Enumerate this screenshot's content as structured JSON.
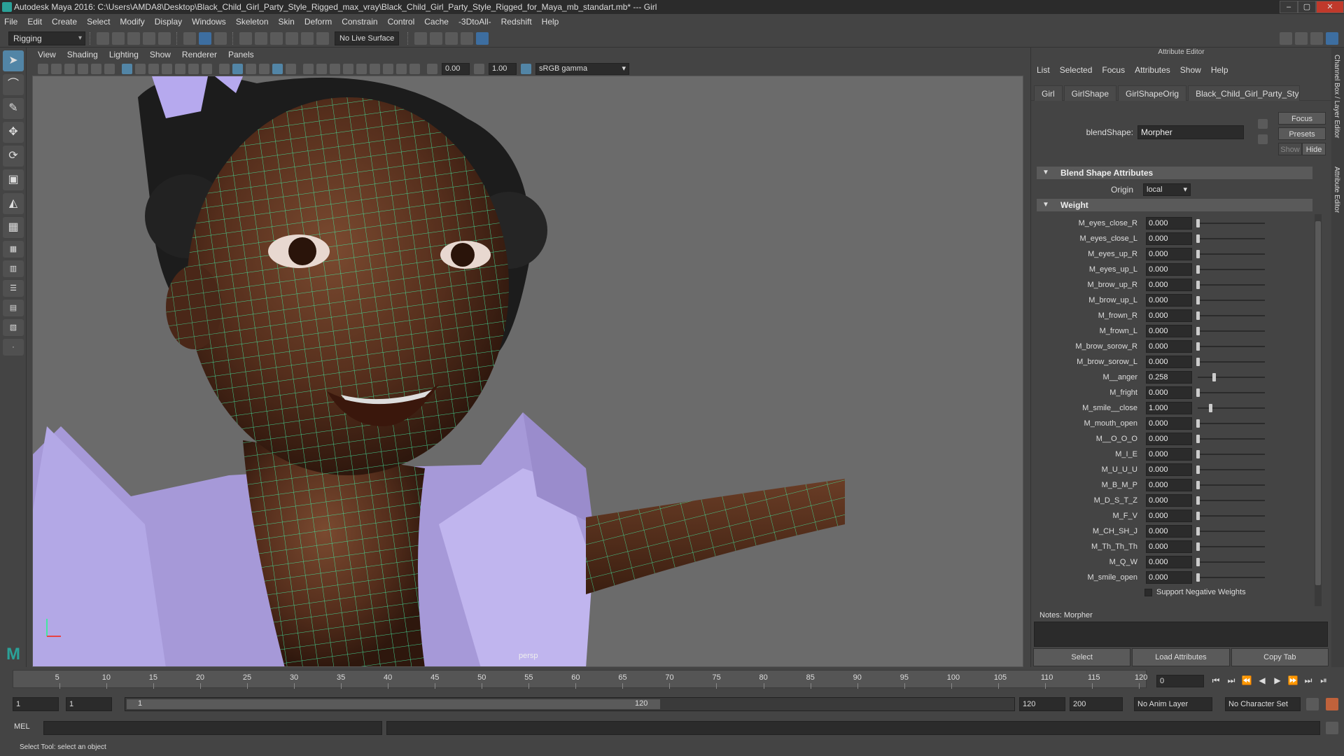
{
  "window": {
    "title": "Autodesk Maya 2016: C:\\Users\\AMDA8\\Desktop\\Black_Child_Girl_Party_Style_Rigged_max_vray\\Black_Child_Girl_Party_Style_Rigged_for_Maya_mb_standart.mb*  ---  Girl"
  },
  "menubar": [
    "File",
    "Edit",
    "Create",
    "Select",
    "Modify",
    "Display",
    "Windows",
    "Skeleton",
    "Skin",
    "Deform",
    "Constrain",
    "Control",
    "Cache",
    "-3DtoAll-",
    "Redshift",
    "Help"
  ],
  "statusline": {
    "menuset": "Rigging",
    "live_surface": "No Live Surface"
  },
  "viewport": {
    "menu": [
      "View",
      "Shading",
      "Lighting",
      "Show",
      "Renderer",
      "Panels"
    ],
    "near_value": "0.00",
    "far_value": "1.00",
    "color_space": "sRGB gamma",
    "camera_label": "persp"
  },
  "attribute_editor": {
    "title": "Attribute Editor",
    "menu": [
      "List",
      "Selected",
      "Focus",
      "Attributes",
      "Show",
      "Help"
    ],
    "tabs": [
      "Girl",
      "GirlShape",
      "GirlShapeOrig",
      "Black_Child_Girl_Party_Style_Rig"
    ],
    "focus_label": "Focus",
    "presets_label": "Presets",
    "show_label": "Show",
    "hide_label": "Hide",
    "blendshape_label": "blendShape:",
    "blendshape_value": "Morpher",
    "section_blend": "Blend Shape Attributes",
    "origin_label": "Origin",
    "origin_value": "local",
    "section_weight": "Weight",
    "weights": [
      {
        "name": "M_eyes_close_R",
        "value": "0.000",
        "level": 0
      },
      {
        "name": "M_eyes_close_L",
        "value": "0.000",
        "level": 0
      },
      {
        "name": "M_eyes_up_R",
        "value": "0.000",
        "level": 0
      },
      {
        "name": "M_eyes_up_L",
        "value": "0.000",
        "level": 0
      },
      {
        "name": "M_brow_up_R",
        "value": "0.000",
        "level": 0
      },
      {
        "name": "M_brow_up_L",
        "value": "0.000",
        "level": 0
      },
      {
        "name": "M_frown_R",
        "value": "0.000",
        "level": 0
      },
      {
        "name": "M_frown_L",
        "value": "0.000",
        "level": 0
      },
      {
        "name": "M_brow_sorow_R",
        "value": "0.000",
        "level": 0
      },
      {
        "name": "M_brow_sorow_L",
        "value": "0.000",
        "level": 0
      },
      {
        "name": "M__anger",
        "value": "0.258",
        "level": 0.258
      },
      {
        "name": "M_fright",
        "value": "0.000",
        "level": 0
      },
      {
        "name": "M_smile__close",
        "value": "1.000",
        "level": 0.2
      },
      {
        "name": "M_mouth_open",
        "value": "0.000",
        "level": 0
      },
      {
        "name": "M__O_O_O",
        "value": "0.000",
        "level": 0
      },
      {
        "name": "M_I_E",
        "value": "0.000",
        "level": 0
      },
      {
        "name": "M_U_U_U",
        "value": "0.000",
        "level": 0
      },
      {
        "name": "M_B_M_P",
        "value": "0.000",
        "level": 0
      },
      {
        "name": "M_D_S_T_Z",
        "value": "0.000",
        "level": 0
      },
      {
        "name": "M_F_V",
        "value": "0.000",
        "level": 0
      },
      {
        "name": "M_CH_SH_J",
        "value": "0.000",
        "level": 0
      },
      {
        "name": "M_Th_Th_Th",
        "value": "0.000",
        "level": 0
      },
      {
        "name": "M_Q_W",
        "value": "0.000",
        "level": 0
      },
      {
        "name": "M_smile_open",
        "value": "0.000",
        "level": 0
      }
    ],
    "support_negative": "Support Negative Weights",
    "notes_label": "Notes:  Morpher",
    "buttons": [
      "Select",
      "Load Attributes",
      "Copy Tab"
    ],
    "side_tabs": [
      "Channel Box / Layer Editor",
      "Attribute Editor"
    ]
  },
  "timeline": {
    "ticks": [
      "5",
      "10",
      "15",
      "20",
      "25",
      "30",
      "35",
      "40",
      "45",
      "50",
      "55",
      "60",
      "65",
      "70",
      "75",
      "80",
      "85",
      "90",
      "95",
      "100",
      "105",
      "110",
      "115",
      "120"
    ],
    "current_frame": "0",
    "playback": [
      "⏮",
      "⏭",
      "⏪",
      "◀",
      "▶",
      "⏩",
      "⏭",
      "⏯"
    ]
  },
  "range": {
    "start_field": "1",
    "start_field2": "1",
    "bar_start": "1",
    "bar_end": "120",
    "end_field": "120",
    "end_field2": "200",
    "anim_layer": "No Anim Layer",
    "char_set": "No Character Set"
  },
  "cmdline": {
    "mel_label": "MEL"
  },
  "helpline": "Select Tool: select an object"
}
